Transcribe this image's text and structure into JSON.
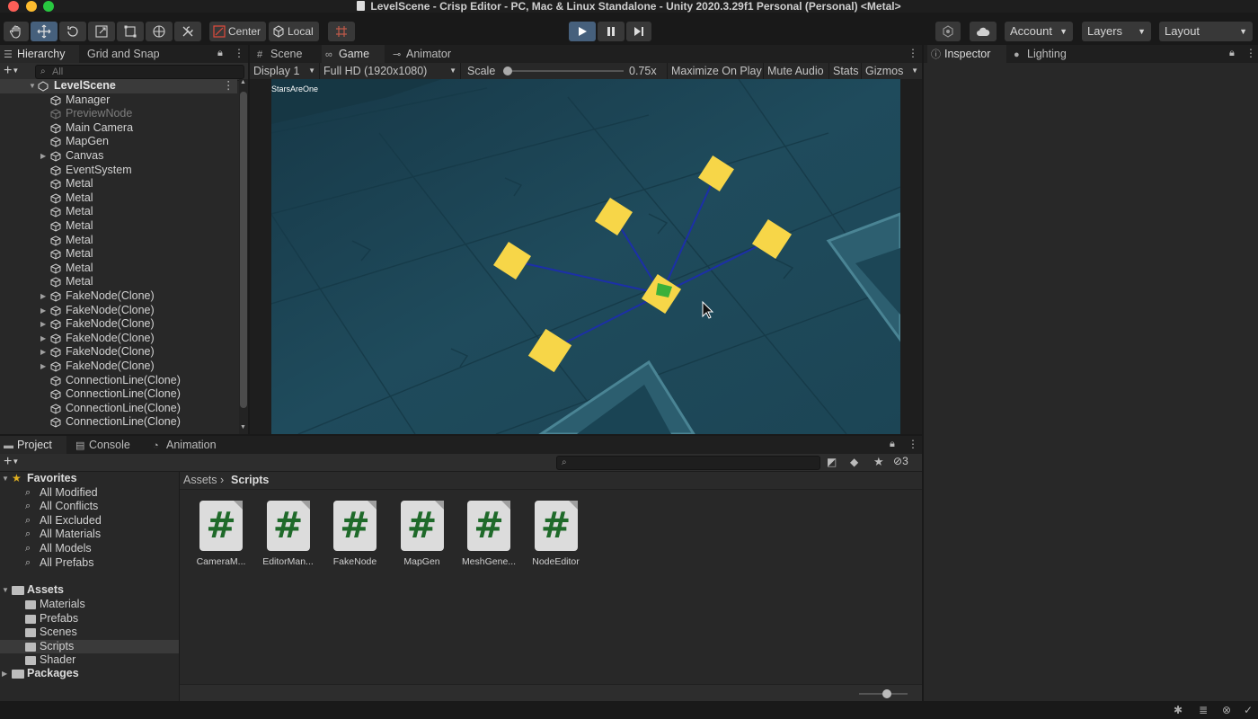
{
  "window": {
    "title": "LevelScene - Crisp Editor - PC, Mac & Linux Standalone - Unity 2020.3.29f1 Personal (Personal) <Metal>"
  },
  "toolbar": {
    "tools": [
      "hand-tool",
      "move-tool",
      "rotate-tool",
      "scale-tool",
      "rect-tool",
      "transform-tool",
      "custom-tool"
    ],
    "active_tool": "move-tool",
    "pivot_label": "Center",
    "space_label": "Local",
    "account_label": "Account",
    "layers_label": "Layers",
    "layout_label": "Layout"
  },
  "hierarchy": {
    "tab_label": "Hierarchy",
    "tab2_label": "Grid and Snap",
    "search_placeholder": "All",
    "scene_name": "LevelScene",
    "items": [
      {
        "label": "Manager",
        "expandable": false,
        "dim": false
      },
      {
        "label": "PreviewNode",
        "expandable": false,
        "dim": true
      },
      {
        "label": "Main Camera",
        "expandable": false,
        "dim": false
      },
      {
        "label": "MapGen",
        "expandable": false,
        "dim": false
      },
      {
        "label": "Canvas",
        "expandable": true,
        "dim": false
      },
      {
        "label": "EventSystem",
        "expandable": false,
        "dim": false
      },
      {
        "label": "Metal",
        "expandable": false,
        "dim": false
      },
      {
        "label": "Metal",
        "expandable": false,
        "dim": false
      },
      {
        "label": "Metal",
        "expandable": false,
        "dim": false
      },
      {
        "label": "Metal",
        "expandable": false,
        "dim": false
      },
      {
        "label": "Metal",
        "expandable": false,
        "dim": false
      },
      {
        "label": "Metal",
        "expandable": false,
        "dim": false
      },
      {
        "label": "Metal",
        "expandable": false,
        "dim": false
      },
      {
        "label": "Metal",
        "expandable": false,
        "dim": false
      },
      {
        "label": "FakeNode(Clone)",
        "expandable": true,
        "dim": false
      },
      {
        "label": "FakeNode(Clone)",
        "expandable": true,
        "dim": false
      },
      {
        "label": "FakeNode(Clone)",
        "expandable": true,
        "dim": false
      },
      {
        "label": "FakeNode(Clone)",
        "expandable": true,
        "dim": false
      },
      {
        "label": "FakeNode(Clone)",
        "expandable": true,
        "dim": false
      },
      {
        "label": "FakeNode(Clone)",
        "expandable": true,
        "dim": false
      },
      {
        "label": "ConnectionLine(Clone)",
        "expandable": false,
        "dim": false
      },
      {
        "label": "ConnectionLine(Clone)",
        "expandable": false,
        "dim": false
      },
      {
        "label": "ConnectionLine(Clone)",
        "expandable": false,
        "dim": false
      },
      {
        "label": "ConnectionLine(Clone)",
        "expandable": false,
        "dim": false
      }
    ]
  },
  "center_tabs": {
    "scene_label": "Scene",
    "game_label": "Game",
    "animator_label": "Animator"
  },
  "game_toolbar": {
    "display_label": "Display 1",
    "resolution_label": "Full HD (1920x1080)",
    "scale_label": "Scale",
    "scale_value": "0.75x",
    "scale_fraction": 0.0,
    "maximize_label": "Maximize On Play",
    "mute_label": "Mute Audio",
    "stats_label": "Stats",
    "gizmos_label": "Gizmos"
  },
  "game_view": {
    "overlay_text": "StarsAreOne",
    "tile_color": "#f7d648",
    "line_color": "#1c2fa8",
    "center_marker_color": "#3bb03a",
    "background_color": "#1f4a5a"
  },
  "right_tabs": {
    "inspector_label": "Inspector",
    "lighting_label": "Lighting"
  },
  "bottom_tabs": {
    "project_label": "Project",
    "console_label": "Console",
    "animation_label": "Animation"
  },
  "project": {
    "hidden_count": "3",
    "favorites_label": "Favorites",
    "favorites": [
      "All Modified",
      "All Conflicts",
      "All Excluded",
      "All Materials",
      "All Models",
      "All Prefabs"
    ],
    "assets_label": "Assets",
    "asset_folders": [
      "Materials",
      "Prefabs",
      "Scenes",
      "Scripts",
      "Shader"
    ],
    "selected_folder": "Scripts",
    "packages_label": "Packages",
    "breadcrumb_root": "Assets",
    "breadcrumb_current": "Scripts",
    "files": [
      "CameraM...",
      "EditorMan...",
      "FakeNode",
      "MapGen",
      "MeshGene...",
      "NodeEditor"
    ]
  },
  "colors": {
    "play_active": "#46607c",
    "selection": "#3a3a3a",
    "favorite_star": "#e0b020"
  }
}
